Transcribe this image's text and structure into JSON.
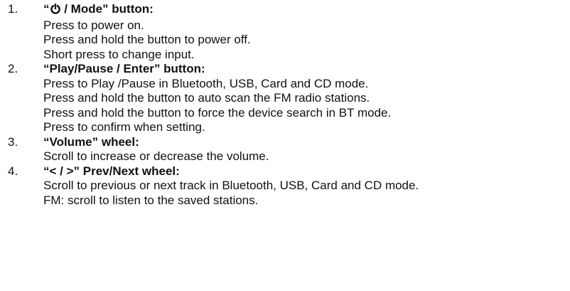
{
  "items": [
    {
      "number": "1.",
      "heading_prefix": "“",
      "heading_icon": "power-icon",
      "heading_suffix": " / Mode” button:",
      "lines": [
        "Press to power on.",
        "Press and hold the button to power off.",
        "Short press to change input."
      ]
    },
    {
      "number": "2.",
      "heading": "“Play/Pause / Enter” button:",
      "lines": [
        "Press to Play /Pause in Bluetooth, USB, Card and CD mode.",
        "Press and hold the button to auto scan the FM radio stations.",
        "Press and hold the button to force the device search in BT mode.",
        "Press to confirm when setting."
      ]
    },
    {
      "number": "3.",
      "heading": "“Volume” wheel:",
      "lines": [
        "Scroll to increase or decrease the volume."
      ]
    },
    {
      "number": "4.",
      "heading": "“< / >” Prev/Next wheel:",
      "lines": [
        "Scroll to previous or next track in Bluetooth, USB, Card and CD mode.",
        "FM: scroll to listen to the saved stations."
      ]
    }
  ]
}
